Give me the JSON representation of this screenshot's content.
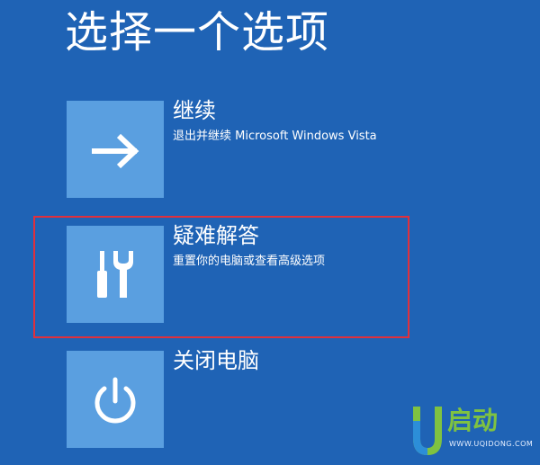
{
  "page": {
    "title": "选择一个选项",
    "background_color": "#1f63b5",
    "tile_color": "#5a9fe0",
    "highlight_color": "#e0303c"
  },
  "options": [
    {
      "title": "继续",
      "description": "退出并继续 Microsoft Windows Vista",
      "icon": "arrow-right-icon"
    },
    {
      "title": "疑难解答",
      "description": "重置你的电脑或查看高级选项",
      "icon": "screwdriver-wrench-icon"
    },
    {
      "title": "关闭电脑",
      "description": "",
      "icon": "power-icon"
    }
  ],
  "watermark": {
    "brand": "启动",
    "url": "WWW.UQIDONG.COM",
    "brand_color": "#7fc241"
  }
}
